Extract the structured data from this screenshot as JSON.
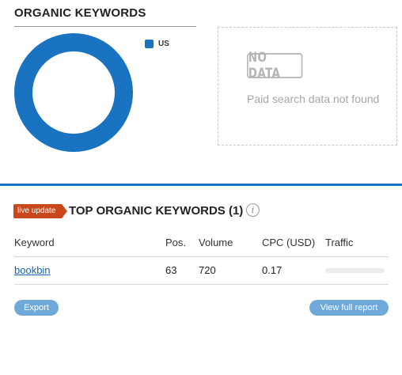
{
  "organic_keywords": {
    "title": "ORGANIC KEYWORDS",
    "chart_data": {
      "type": "pie",
      "labels": [
        "US"
      ],
      "values": [
        100
      ],
      "colors": [
        "#1a73c1"
      ],
      "legend_position": "top-right"
    },
    "legend": [
      {
        "label": "US",
        "color": "#1a73c1"
      }
    ]
  },
  "paid_panel": {
    "badge": "NO DATA",
    "message": "Paid search data not found"
  },
  "top_keywords": {
    "badge": "live update",
    "title": "TOP ORGANIC KEYWORDS (1)",
    "info_icon": "info-icon",
    "columns": [
      "Keyword",
      "Pos.",
      "Volume",
      "CPC (USD)",
      "Traffic"
    ],
    "rows": [
      {
        "keyword": "bookbin",
        "pos": "63",
        "volume": "720",
        "cpc": "0.17",
        "traffic_share": 0
      }
    ],
    "export_label": "Export",
    "full_report_label": "View full report"
  },
  "colors": {
    "accent": "#1a73c1",
    "live_badge": "#c8481c",
    "button": "#6fa9d9",
    "link": "#1a63b0"
  }
}
